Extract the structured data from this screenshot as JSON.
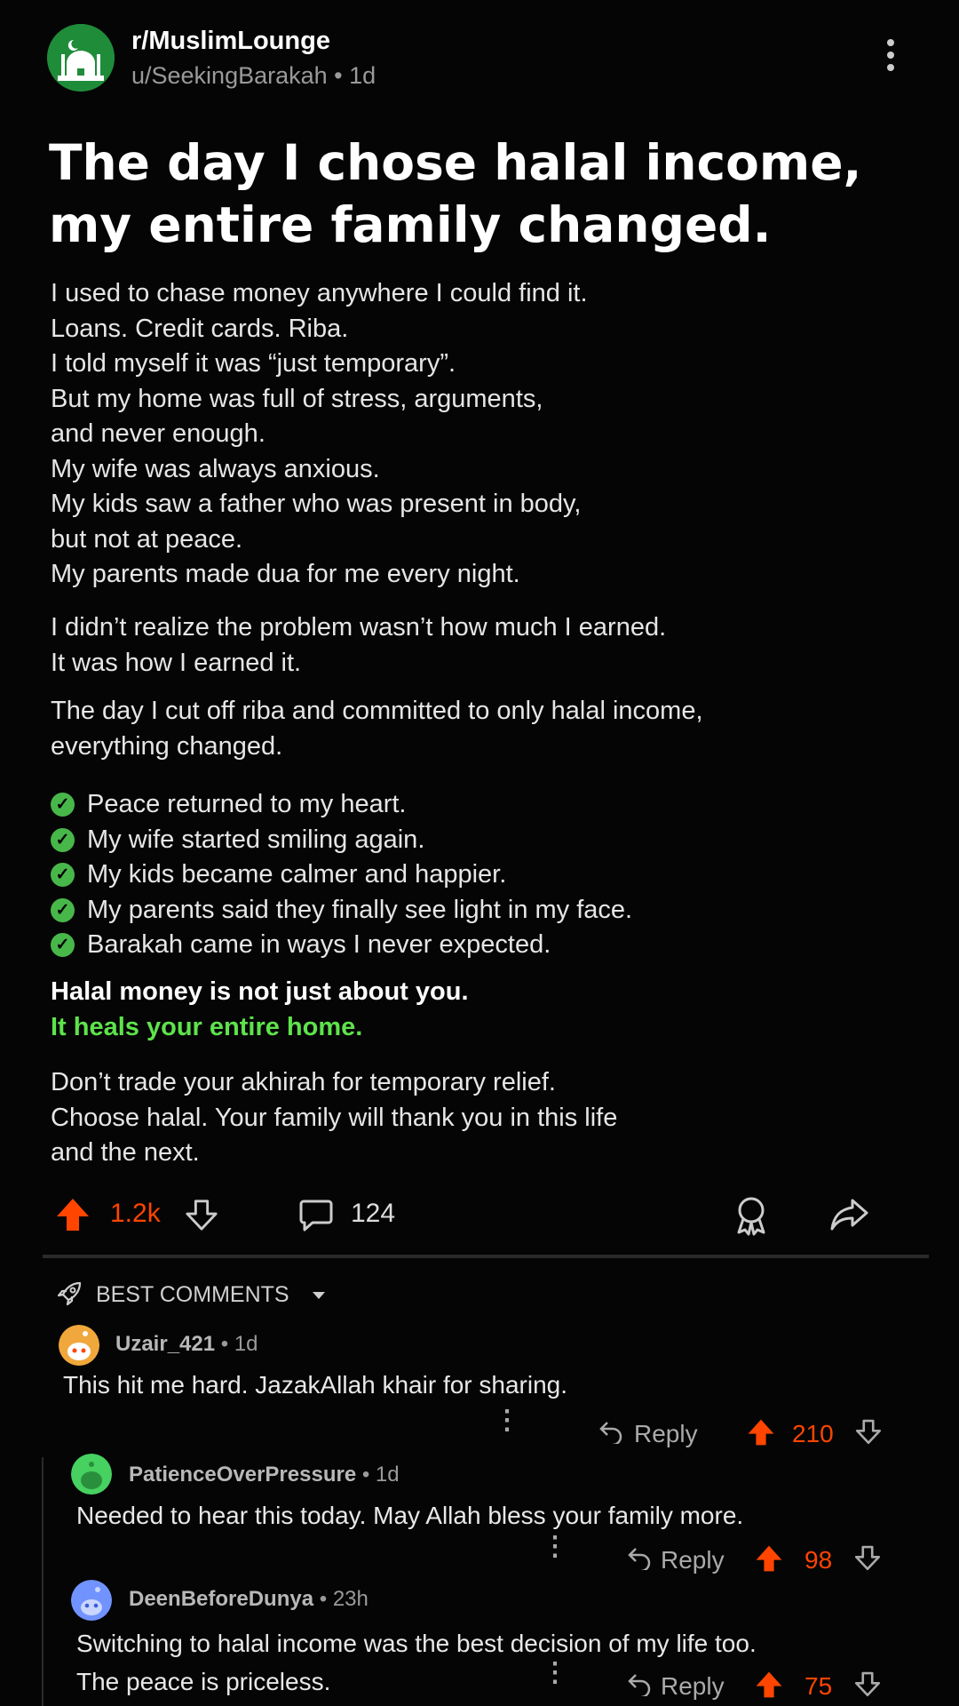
{
  "post": {
    "subreddit": "r/MuslimLounge",
    "author": "u/SeekingBarakah",
    "age": "1d",
    "title_lines": [
      "The day I chose halal income,",
      "my entire family changed."
    ],
    "para1": [
      "I used to chase money anywhere I could find it.",
      "Loans. Credit cards. Riba.",
      "I told myself it was “just temporary”.",
      "But my home was full of stress, arguments,",
      "and never enough.",
      "My wife was always anxious.",
      "My kids saw a father who was present in body,",
      "but not at peace.",
      "My parents made dua for me every night."
    ],
    "para2": [
      "I didn’t realize the problem wasn’t how much I earned.",
      "It was how I earned it."
    ],
    "para3": [
      "The day I cut off riba and committed to only halal income,",
      "everything changed."
    ],
    "checklist": [
      "Peace returned to my heart.",
      "My wife started smiling again.",
      "My kids became calmer and happier.",
      "My parents said they finally see light in my face.",
      "Barakah came in ways I never expected."
    ],
    "bold_line": "Halal money is not just about you.",
    "green_line": "It heals your entire home.",
    "para4": [
      "Don’t trade your akhirah for temporary relief.",
      "Choose halal. Your family will thank you in this life",
      "and the next."
    ],
    "upvotes": "1.2k",
    "comments_count": "124"
  },
  "sort_label": "BEST COMMENTS",
  "comments": [
    {
      "user": "Uzair_421",
      "age": "1d",
      "text": [
        "This hit me hard. JazakAllah khair for sharing."
      ],
      "reply": "Reply",
      "votes": "210",
      "avatar_color": "#f0a83c"
    },
    {
      "user": "PatienceOverPressure",
      "age": "1d",
      "text": [
        "Needed to hear this today. May Allah bless your family more."
      ],
      "reply": "Reply",
      "votes": "98",
      "avatar_color": "#46d160"
    },
    {
      "user": "DeenBeforeDunya",
      "age": "23h",
      "text": [
        "Switching to halal income was the best decision of my life too.",
        "The peace is priceless."
      ],
      "reply": "Reply",
      "votes": "75",
      "avatar_color": "#7193ff"
    }
  ],
  "colors": {
    "accent": "#ff4500",
    "green": "#5ee34c",
    "check": "#48b74a"
  },
  "icons": [
    "mosque-icon",
    "kebab-icon",
    "upvote-icon",
    "downvote-icon",
    "comment-icon",
    "award-icon",
    "share-icon",
    "rocket-icon",
    "caret-down-icon",
    "reply-icon",
    "snoo-avatar-icon",
    "check-icon"
  ]
}
